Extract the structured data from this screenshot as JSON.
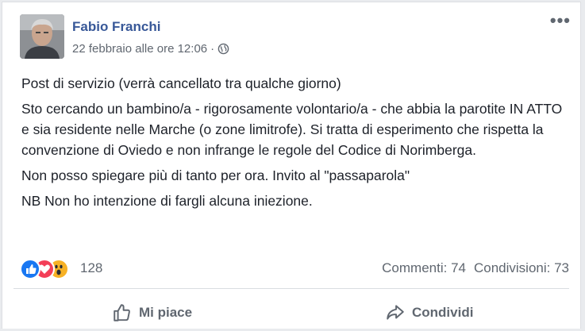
{
  "post": {
    "author": "Fabio Franchi",
    "timestamp": "22 febbraio alle ore 12:06",
    "meta_separator": "·",
    "privacy_icon": "globe-icon",
    "more_label": "•••",
    "paragraphs": [
      "Post di servizio (verrà cancellato tra qualche giorno)",
      "Sto cercando un bambino/a - rigorosamente volontario/a - che abbia la parotite IN ATTO e sia residente nelle Marche (o zone limitrofe). Si tratta di esperimento che rispetta la convenzione di Oviedo e non infrange le regole del Codice di Norimberga.",
      "Non posso spiegare più di tanto per ora. Invito al \"passaparola\"",
      "NB Non ho intenzione di fargli alcuna iniezione."
    ]
  },
  "reactions": {
    "icons": [
      "like-icon",
      "love-icon",
      "wow-icon"
    ],
    "count": "128",
    "comments": "Commenti: 74",
    "shares": "Condivisioni: 73"
  },
  "actions": {
    "like_label": "Mi piace",
    "share_label": "Condividi"
  },
  "colors": {
    "author": "#385898",
    "secondary_text": "#606770",
    "like": "#1877f2",
    "love": "#f33e58",
    "wow": "#f7b125"
  }
}
